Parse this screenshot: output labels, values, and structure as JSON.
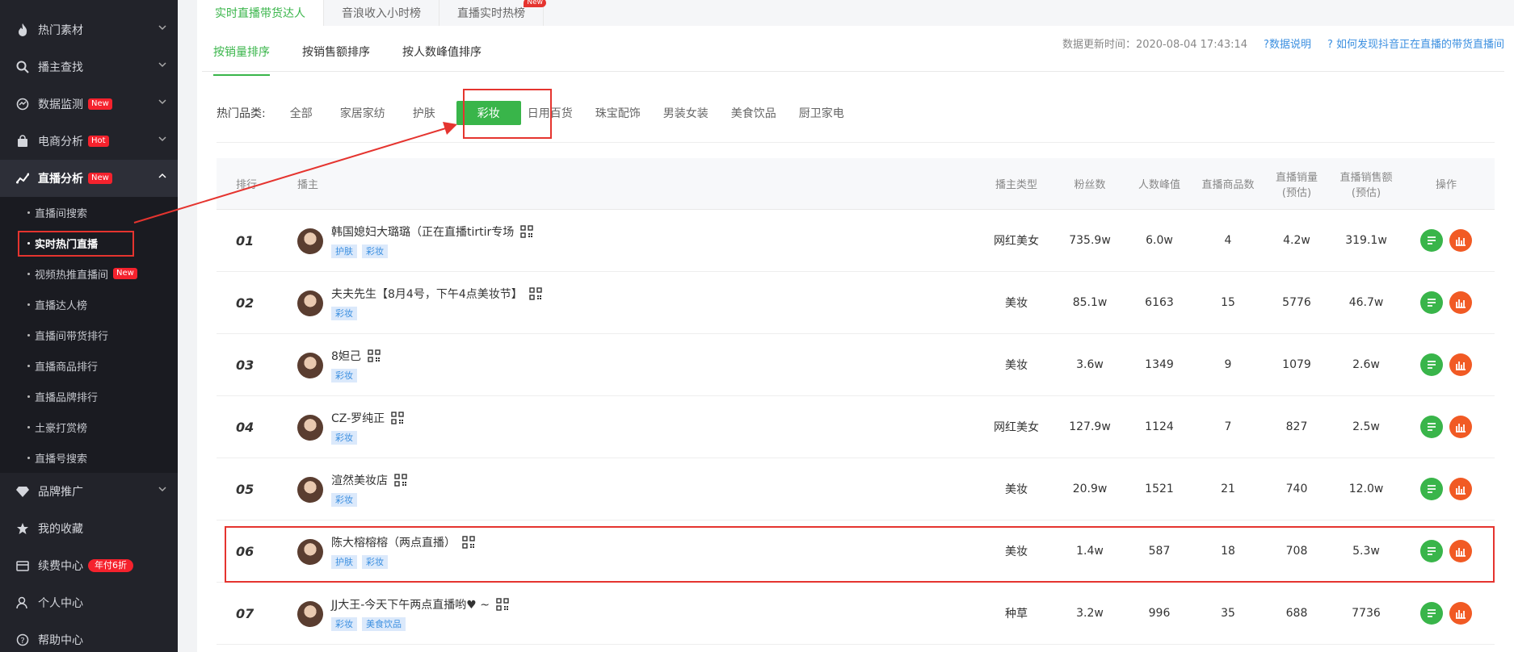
{
  "sidebar": {
    "items": [
      {
        "label": "热门素材",
        "icon": "flame-icon"
      },
      {
        "label": "播主查找",
        "icon": "search-icon"
      },
      {
        "label": "数据监测",
        "icon": "monitor-icon",
        "badge": "New"
      },
      {
        "label": "电商分析",
        "icon": "bag-icon",
        "badge": "Hot"
      },
      {
        "label": "直播分析",
        "icon": "trend-icon",
        "badge": "New"
      }
    ],
    "sub_items": [
      {
        "label": "直播间搜索"
      },
      {
        "label": "实时热门直播"
      },
      {
        "label": "视频热推直播间",
        "badge": "New"
      },
      {
        "label": "直播达人榜"
      },
      {
        "label": "直播间带货排行"
      },
      {
        "label": "直播商品排行"
      },
      {
        "label": "直播品牌排行"
      },
      {
        "label": "土豪打赏榜"
      },
      {
        "label": "直播号搜索"
      }
    ],
    "bottom_items": [
      {
        "label": "品牌推广",
        "icon": "diamond-icon"
      },
      {
        "label": "我的收藏",
        "icon": "star-icon"
      },
      {
        "label": "续费中心",
        "icon": "wallet-icon",
        "badge": "年付6折"
      },
      {
        "label": "个人中心",
        "icon": "user-icon"
      },
      {
        "label": "帮助中心",
        "icon": "help-icon"
      }
    ]
  },
  "top_tabs": [
    {
      "label": "实时直播带货达人"
    },
    {
      "label": "音浪收入小时榜"
    },
    {
      "label": "直播实时热榜",
      "badge": "New"
    }
  ],
  "sub_tabs": [
    {
      "label": "按销量排序"
    },
    {
      "label": "按销售额排序"
    },
    {
      "label": "按人数峰值排序"
    }
  ],
  "update": {
    "time": "数据更新时间：2020-08-04 17:43:14",
    "help1": "?数据说明",
    "help2": "? 如何发现抖音正在直播的带货直播间"
  },
  "categories": {
    "label": "热门品类:",
    "items": [
      "全部",
      "家居家纺",
      "护肤",
      "彩妆",
      "日用百货",
      "珠宝配饰",
      "男装女装",
      "美食饮品",
      "厨卫家电"
    ],
    "selected": "彩妆"
  },
  "table": {
    "headers": {
      "rank": "排行",
      "anchor": "播主",
      "type": "播主类型",
      "fans": "粉丝数",
      "peak": "人数峰值",
      "goods": "直播商品数",
      "sales1": "直播销量",
      "sales2": "(预估)",
      "amount1": "直播销售额",
      "amount2": "(预估)",
      "op": "操作"
    },
    "rows": [
      {
        "rank": "01",
        "name": "韩国媳妇大璐璐（正在直播tirtir专场",
        "tags": [
          "护肤",
          "彩妆"
        ],
        "type": "网红美女",
        "fans": "735.9w",
        "peak": "6.0w",
        "goods": "4",
        "sales": "4.2w",
        "amount": "319.1w"
      },
      {
        "rank": "02",
        "name": "夫夫先生【8月4号，下午4点美妆节】",
        "tags": [
          "彩妆"
        ],
        "type": "美妆",
        "fans": "85.1w",
        "peak": "6163",
        "goods": "15",
        "sales": "5776",
        "amount": "46.7w"
      },
      {
        "rank": "03",
        "name": "8妲己",
        "tags": [
          "彩妆"
        ],
        "type": "美妆",
        "fans": "3.6w",
        "peak": "1349",
        "goods": "9",
        "sales": "1079",
        "amount": "2.6w"
      },
      {
        "rank": "04",
        "name": "CZ-罗纯正",
        "tags": [
          "彩妆"
        ],
        "type": "网红美女",
        "fans": "127.9w",
        "peak": "1124",
        "goods": "7",
        "sales": "827",
        "amount": "2.5w"
      },
      {
        "rank": "05",
        "name": "渲然美妆店",
        "tags": [
          "彩妆"
        ],
        "type": "美妆",
        "fans": "20.9w",
        "peak": "1521",
        "goods": "21",
        "sales": "740",
        "amount": "12.0w"
      },
      {
        "rank": "06",
        "name": "陈大榕榕榕（两点直播）",
        "tags": [
          "护肤",
          "彩妆"
        ],
        "type": "美妆",
        "fans": "1.4w",
        "peak": "587",
        "goods": "18",
        "sales": "708",
        "amount": "5.3w"
      },
      {
        "rank": "07",
        "name": "JJ大王-今天下午两点直播哟♥ ~",
        "tags": [
          "彩妆",
          "美食饮品"
        ],
        "type": "种草",
        "fans": "3.2w",
        "peak": "996",
        "goods": "35",
        "sales": "688",
        "amount": "7736"
      }
    ]
  }
}
